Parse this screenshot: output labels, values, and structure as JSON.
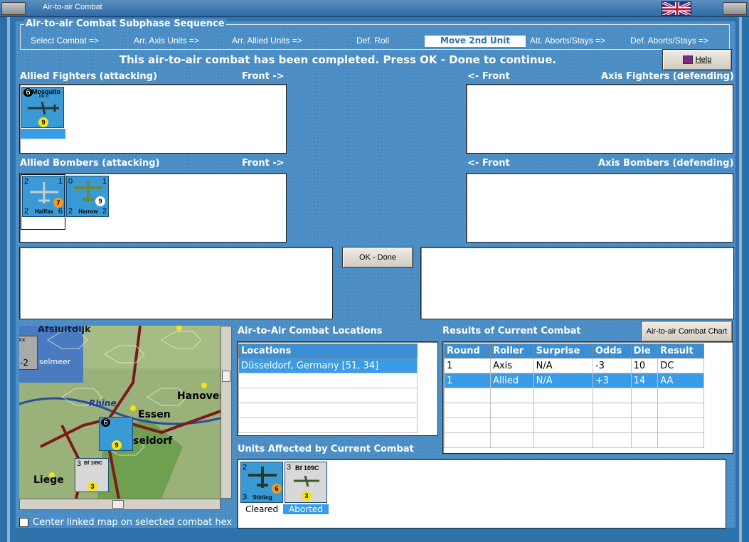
{
  "window": {
    "title": "Air-to-air Combat"
  },
  "sequence": {
    "title": "Air-to-air Combat Subphase Sequence",
    "steps": [
      "Select Combat =>",
      "Arr. Axis Units =>",
      "Arr. Allied Units =>",
      "Def. Roll",
      "Move 2nd Unit",
      "Att. Aborts/Stays =>",
      "Def. Aborts/Stays =>"
    ],
    "active_index": 4
  },
  "message": "This air-to-air combat has been completed.  Press OK - Done to continue.",
  "buttons": {
    "help": "Help",
    "ok_done": "OK - Done",
    "chart": "Air-to-air Combat Chart"
  },
  "sections": {
    "allied_fighters": "Allied Fighters (attacking)",
    "axis_fighters": "Axis Fighters (defending)",
    "allied_bombers": "Allied Bombers (attacking)",
    "axis_bombers": "Axis Bombers (defending)",
    "front_right": "Front ->",
    "front_left": "<- Front",
    "locations": "Air-to-Air Combat Locations",
    "results": "Results of Current Combat",
    "affected": "Units Affected by Current Combat"
  },
  "units": {
    "mosquito": {
      "name": "Mosquito",
      "mark": "Mk II",
      "tl": "6",
      "val": "9"
    },
    "halifax": {
      "name": "Halifax",
      "tl": "2",
      "tr": "1",
      "bl": "2",
      "br": "6",
      "val": "7"
    },
    "harrow": {
      "name": "Harrow",
      "tl": "0",
      "tr": "1",
      "bl": "2",
      "br": "2",
      "val": "9"
    },
    "stirling": {
      "name": "Stirling",
      "tl": "2",
      "bl": "3",
      "val": "6",
      "status": "Cleared"
    },
    "bf109": {
      "name": "Bf 109C",
      "tl": "3",
      "val": "3",
      "status": "Aborted"
    }
  },
  "locations": {
    "header": "Locations",
    "rows": [
      "Düsseldorf, Germany [51, 34]"
    ]
  },
  "results": {
    "headers": [
      "Round",
      "Roller",
      "Surprise",
      "Odds",
      "Die",
      "Result"
    ],
    "rows": [
      [
        "1",
        "Axis",
        "N/A",
        "-3",
        "10",
        "DC"
      ],
      [
        "1",
        "Allied",
        "N/A",
        "+3",
        "14",
        "AA"
      ]
    ]
  },
  "map": {
    "labels": [
      "Afsluitdijk",
      "selmeer",
      "Rhine",
      "Essen",
      "Hanover",
      "seldorf",
      "Liege",
      "-2",
      "xx"
    ]
  },
  "checkbox": {
    "label": "Center linked map on selected combat hex",
    "checked": false
  },
  "colors": {
    "accent": "#3a9be6",
    "background": "#4a8dc4"
  }
}
